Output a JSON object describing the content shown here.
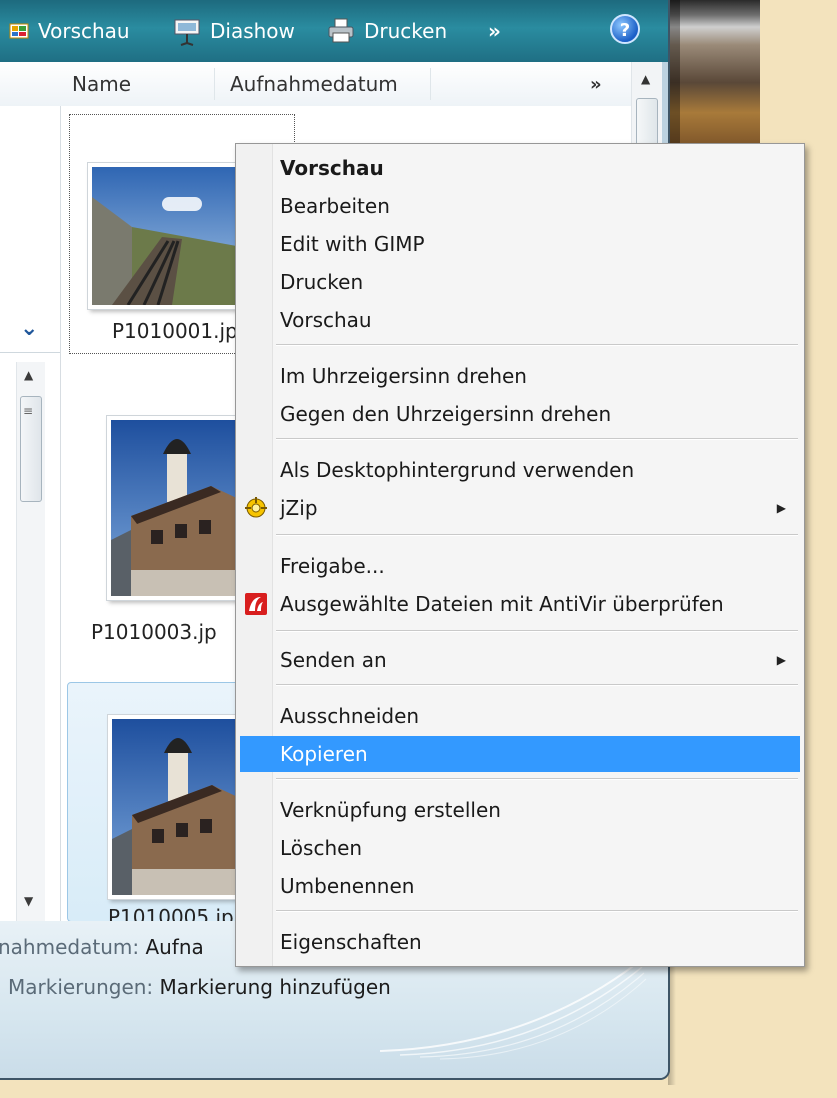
{
  "toolbar": {
    "preview": "Vorschau",
    "slideshow": "Diashow",
    "print": "Drucken",
    "more": "»",
    "help": "?"
  },
  "columns": {
    "name": "Name",
    "date_taken": "Aufnahmedatum",
    "more": "»"
  },
  "files": [
    {
      "name": "P1010001.jp"
    },
    {
      "name": "P1010003.jp"
    },
    {
      "name": "P1010005.jp"
    }
  ],
  "details": {
    "date_label": "nahmedatum:",
    "date_value": "Aufna",
    "tags_label": "Markierungen:",
    "tags_value": "Markierung hinzufügen"
  },
  "context_menu": {
    "items": [
      {
        "label": "Vorschau"
      },
      {
        "label": "Bearbeiten"
      },
      {
        "label": "Edit with GIMP"
      },
      {
        "label": "Drucken"
      },
      {
        "label": "Vorschau"
      },
      {
        "label": "Im Uhrzeigersinn drehen"
      },
      {
        "label": "Gegen den Uhrzeigersinn drehen"
      },
      {
        "label": "Als Desktophintergrund verwenden"
      },
      {
        "label": "jZip"
      },
      {
        "label": "Freigabe..."
      },
      {
        "label": "Ausgewählte Dateien mit AntiVir überprüfen"
      },
      {
        "label": "Senden an"
      },
      {
        "label": "Ausschneiden"
      },
      {
        "label": "Kopieren"
      },
      {
        "label": "Verknüpfung erstellen"
      },
      {
        "label": "Löschen"
      },
      {
        "label": "Umbenennen"
      },
      {
        "label": "Eigenschaften"
      }
    ],
    "highlighted": "Kopieren",
    "highlight_color": "#3399ff"
  },
  "icons": {
    "preview": "preview-icon",
    "slideshow": "slideshow-icon",
    "print": "printer-icon",
    "help": "help-icon",
    "jzip": "jzip-icon",
    "antivir": "antivir-icon",
    "submenu": "submenu-arrow-icon"
  }
}
